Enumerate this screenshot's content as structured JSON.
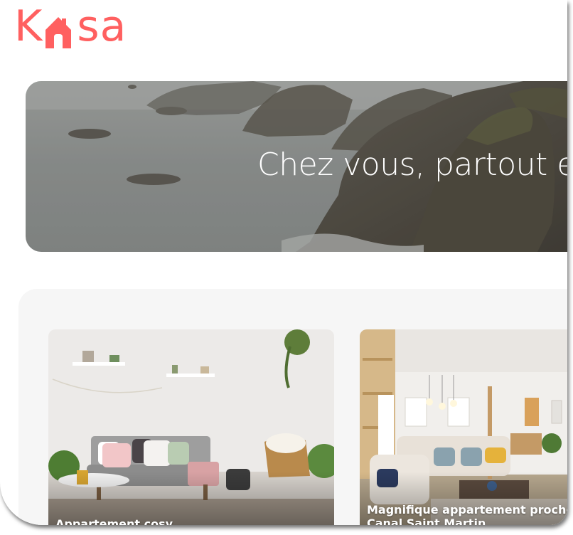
{
  "header": {
    "logo_prefix": "K",
    "logo_suffix": "sa",
    "logo_color": "#ff6060"
  },
  "banner": {
    "title": "Chez vous, partout et ailleurs"
  },
  "gallery": {
    "background": "#f6f6f6",
    "cards": [
      {
        "title": "Appartement cosy"
      },
      {
        "title": "Magnifique appartement proche Canal Saint Martin"
      }
    ]
  }
}
